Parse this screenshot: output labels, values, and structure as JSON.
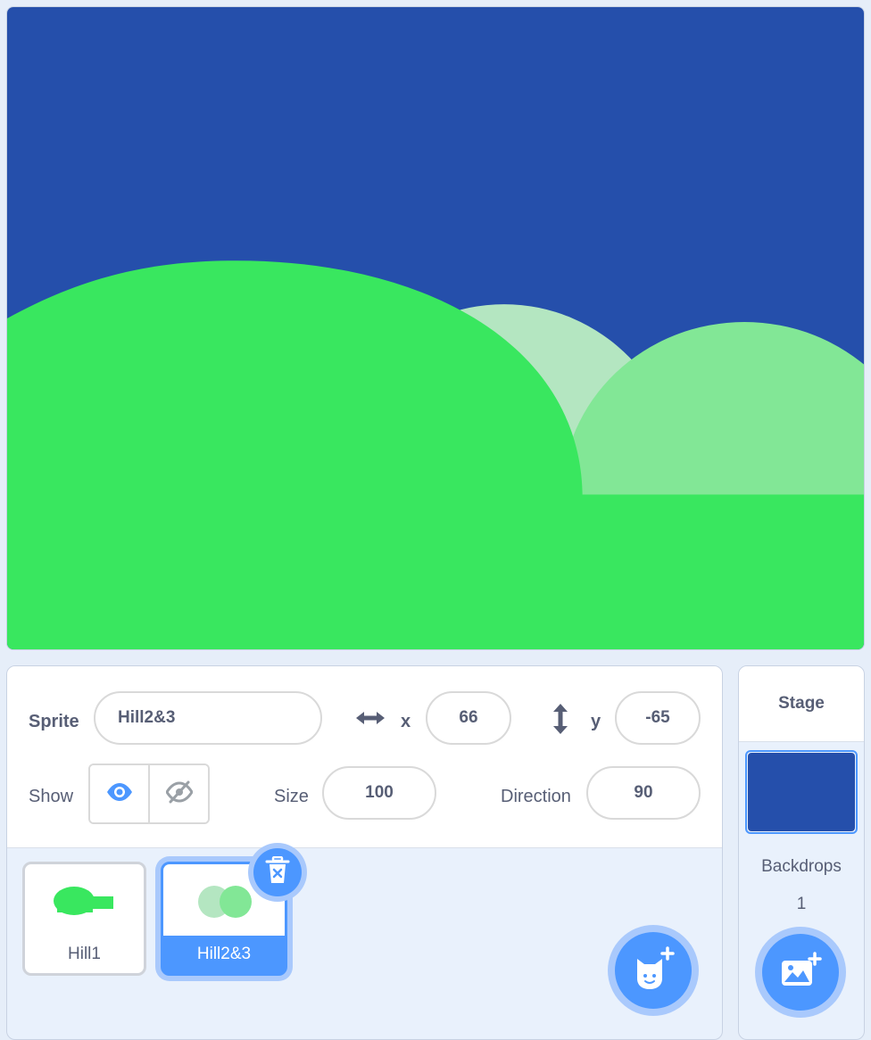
{
  "colors": {
    "sky": "#254fab",
    "hill_front": "#39e75f",
    "hill_back_light": "#b4e6c1",
    "hill_mid": "#82e796",
    "accent": "#4c97ff"
  },
  "sprite_info": {
    "sprite_label": "Sprite",
    "sprite_name": "Hill2&3",
    "x_label": "x",
    "x_value": "66",
    "y_label": "y",
    "y_value": "-65",
    "show_label": "Show",
    "size_label": "Size",
    "size_value": "100",
    "direction_label": "Direction",
    "direction_value": "90",
    "icons": {
      "x": "horizontal-arrows-icon",
      "y": "vertical-arrows-icon",
      "show": "eye-icon",
      "hide": "eye-slash-icon"
    }
  },
  "sprites": [
    {
      "name": "Hill1",
      "selected": false
    },
    {
      "name": "Hill2&3",
      "selected": true
    }
  ],
  "stage_panel": {
    "title": "Stage",
    "backdrops_label": "Backdrops",
    "backdrops_count": "1"
  }
}
